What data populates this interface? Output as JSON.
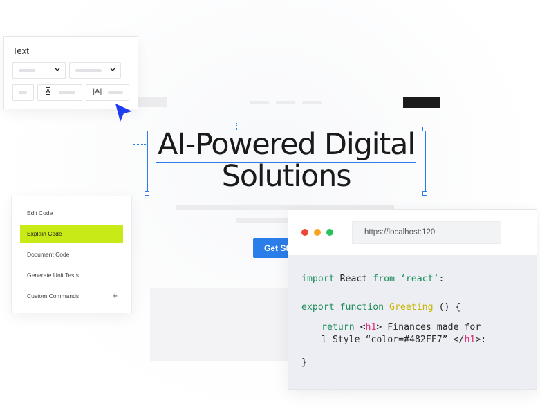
{
  "text_panel": {
    "title": "Text",
    "icons": {
      "align": "text-align-icon",
      "text_size": "text-size-icon"
    },
    "align_glyph": "A",
    "text_size_glyph": "|A|"
  },
  "headline": {
    "line1": "AI-Powered Digital",
    "line2": "Solutions"
  },
  "cta": {
    "label": "Get Started"
  },
  "menu": {
    "items": [
      {
        "label": "Edit Code",
        "active": false
      },
      {
        "label": "Explain Code",
        "active": true
      },
      {
        "label": "Document Code",
        "active": false
      },
      {
        "label": "Generate Unit Tests",
        "active": false
      },
      {
        "label": "Custom Commands",
        "active": false
      }
    ],
    "add_icon": "plus-icon",
    "accent": "#c8ea16"
  },
  "code_window": {
    "url": "https://localhost:120",
    "dots": [
      "#f0433a",
      "#f5a623",
      "#27c25c"
    ],
    "code": {
      "l1_kw1": "import",
      "l1_mid": " React ",
      "l1_kw2": "from",
      "l1_str": " ‘react’",
      "l1_end": ":",
      "l2_kw": "export function",
      "l2_fn": " Greeting",
      "l2_end": " () {",
      "l3_kw": "return",
      "l3_a": " <",
      "l3_tag": "h1",
      "l3_b": "> Finances made for",
      "l4_a": "l Style “color=#482FF7” </",
      "l4_tag": "h1",
      "l4_b": ">:",
      "l5": "}"
    }
  },
  "colors": {
    "accent_blue": "#2b7de9",
    "menu_highlight": "#c8ea16"
  }
}
